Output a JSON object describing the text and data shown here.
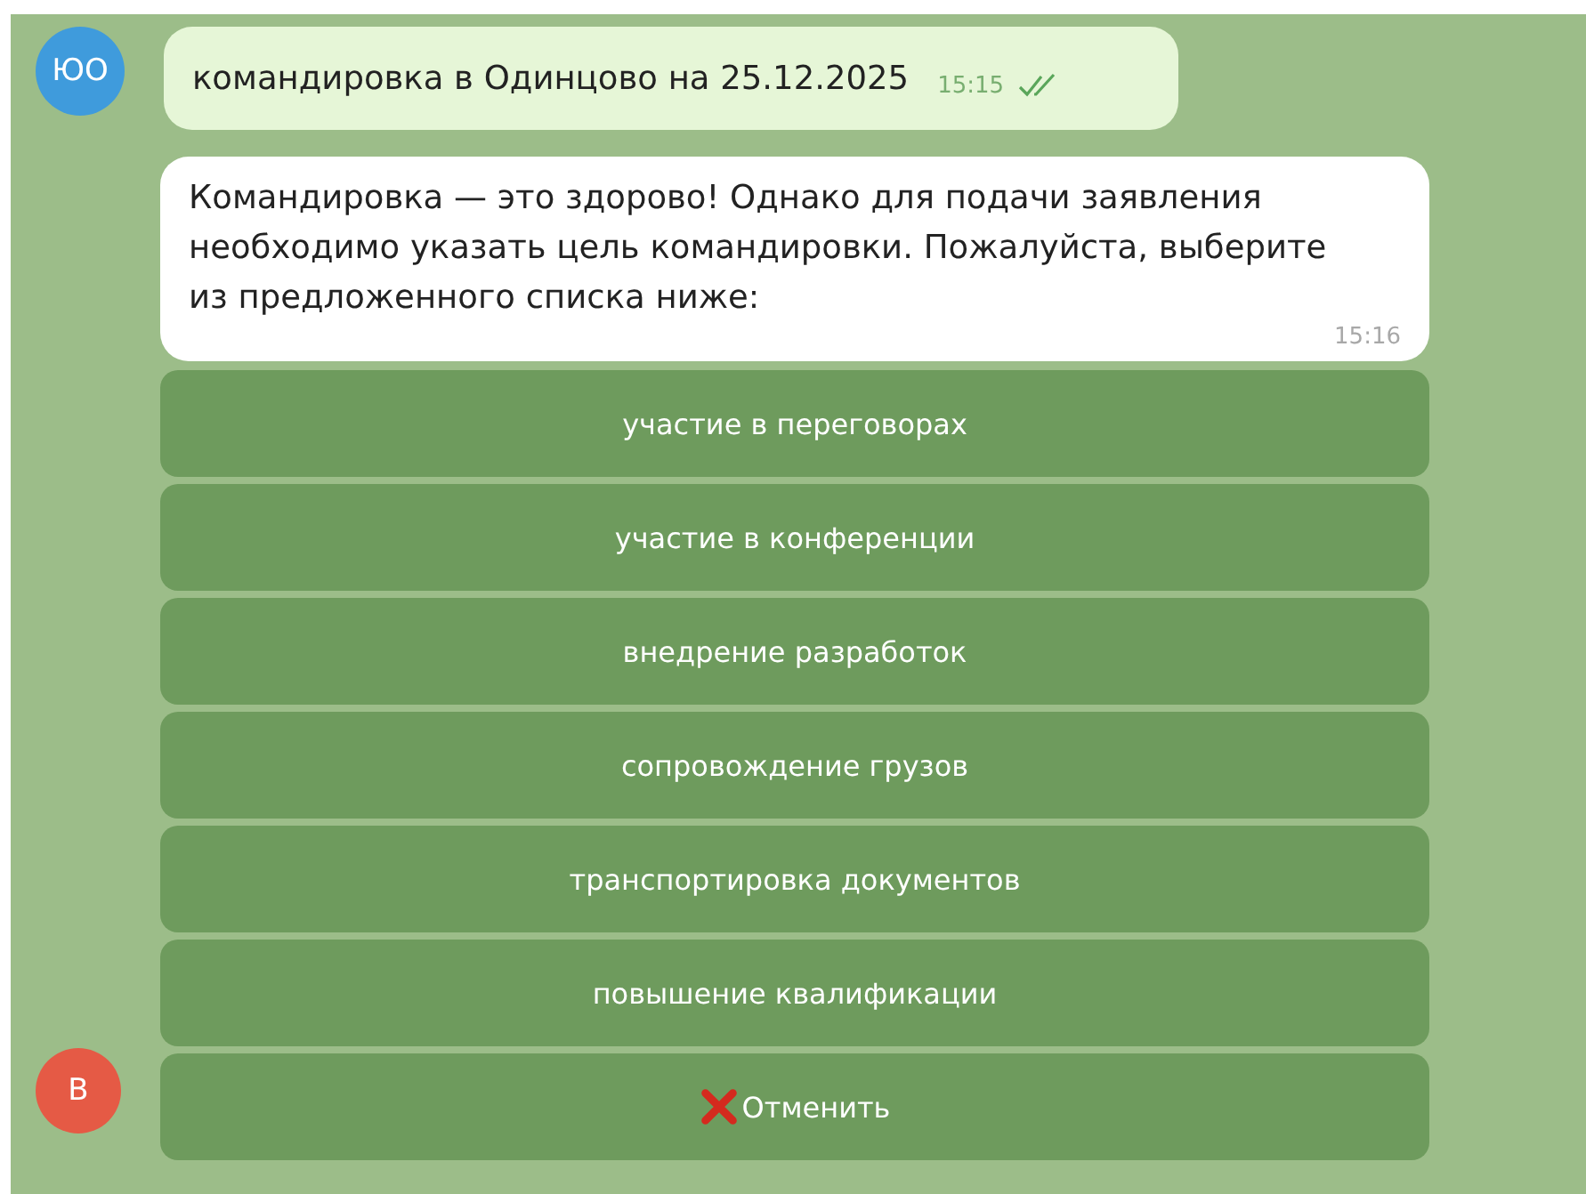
{
  "messages": [
    {
      "kind": "outgoing",
      "avatar": "ЮО",
      "text": "командировка в Одинцово на 25.12.2025",
      "time": "15:15",
      "read": true
    },
    {
      "kind": "incoming",
      "avatar": "B",
      "text": "Командировка — это здорово! Однако для подачи заявления необходимо указать цель командировки. Пожалуйста, выберите из предложенного списка ниже:",
      "time": "15:16"
    }
  ],
  "keyboard": [
    {
      "label": "участие в переговорах",
      "kind": "option"
    },
    {
      "label": "участие в конференции",
      "kind": "option"
    },
    {
      "label": "внедрение разработок",
      "kind": "option"
    },
    {
      "label": "сопровождение грузов",
      "kind": "option"
    },
    {
      "label": "транспортировка документов",
      "kind": "option"
    },
    {
      "label": "повышение квалификации",
      "kind": "option"
    },
    {
      "label": "Отменить",
      "kind": "cancel"
    }
  ]
}
